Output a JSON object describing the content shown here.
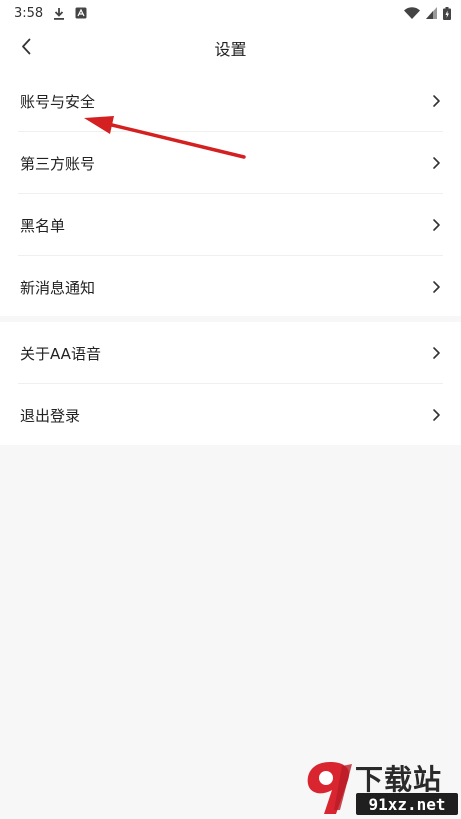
{
  "status_bar": {
    "time": "3:58"
  },
  "header": {
    "title": "设置"
  },
  "groups": [
    {
      "items": [
        {
          "label": "账号与安全"
        },
        {
          "label": "第三方账号"
        },
        {
          "label": "黑名单"
        },
        {
          "label": "新消息通知"
        }
      ]
    },
    {
      "items": [
        {
          "label": "关于AA语音"
        },
        {
          "label": "退出登录"
        }
      ]
    }
  ],
  "watermark": {
    "top_text": "下载站",
    "bottom_text": "91xz.net"
  },
  "colors": {
    "background": "#f7f7f7",
    "surface": "#ffffff",
    "annotation_red": "#d42020",
    "watermark_red": "#d9252f"
  },
  "icons": {
    "back": "chevron-left-icon",
    "row": "chevron-right-icon",
    "download": "download-icon",
    "app": "app-notification-icon",
    "wifi": "wifi-icon",
    "signal": "signal-icon",
    "battery": "battery-icon"
  }
}
